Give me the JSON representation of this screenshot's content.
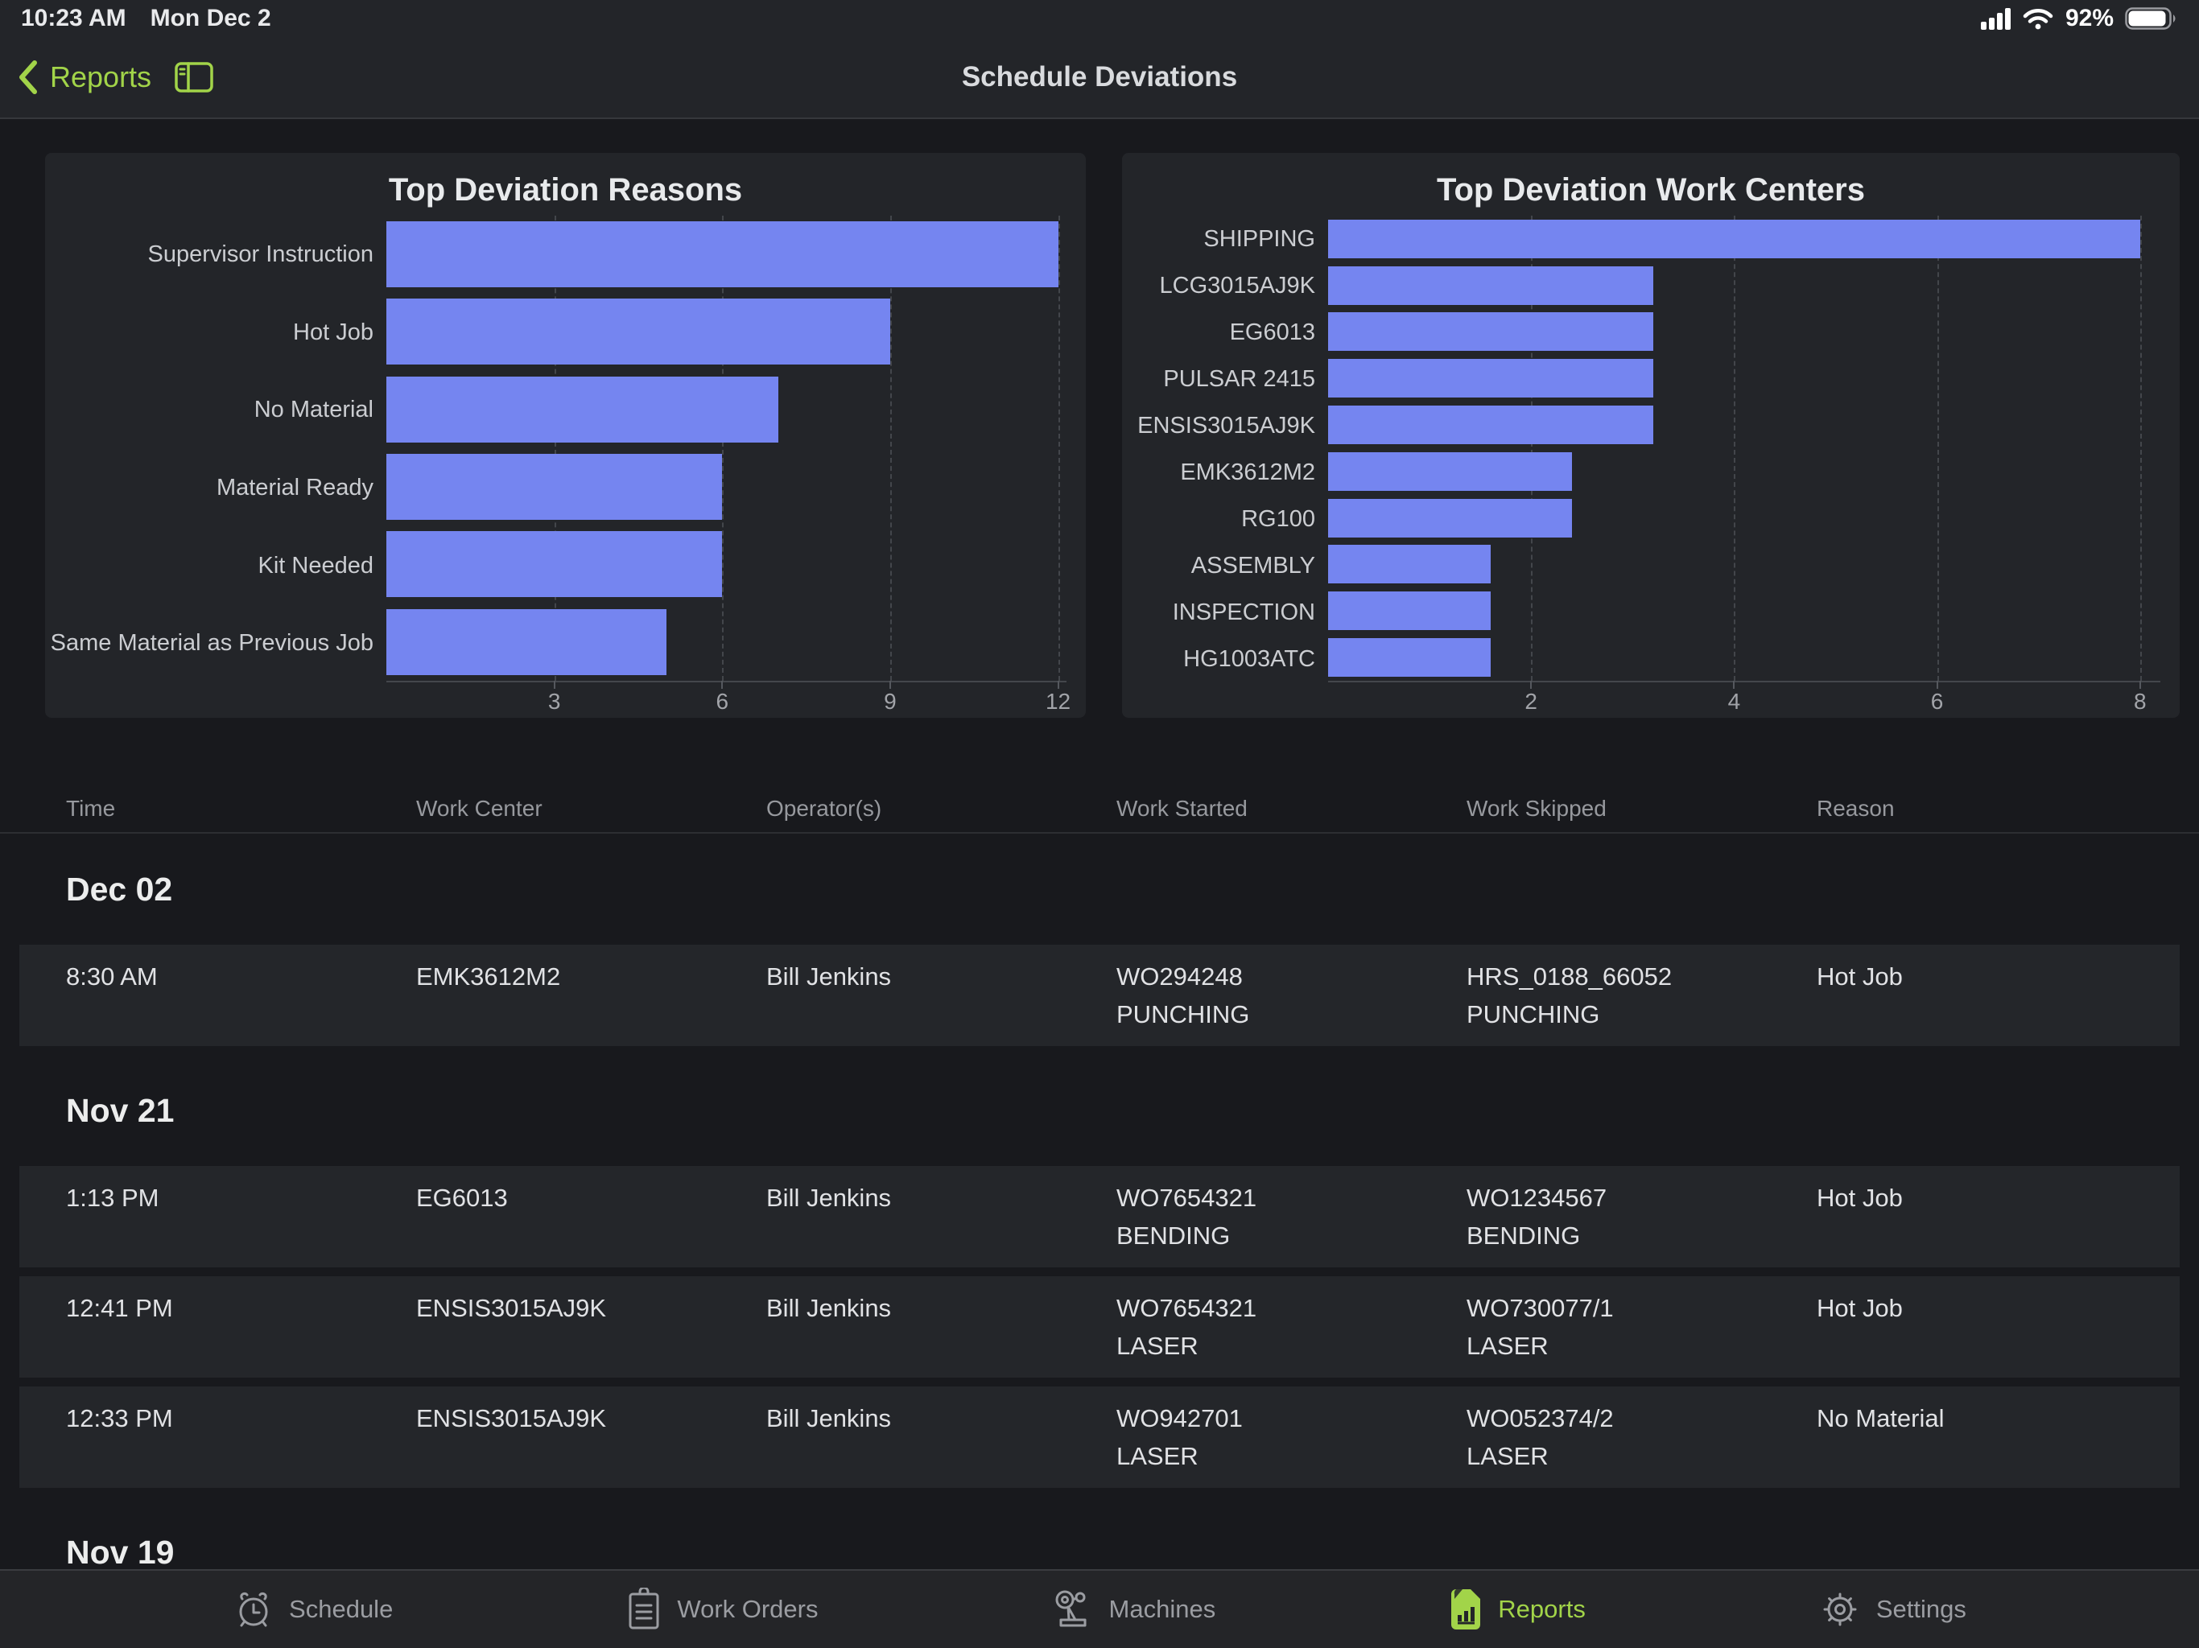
{
  "status_bar": {
    "time": "10:23 AM",
    "date": "Mon Dec 2",
    "battery_percent": "92%"
  },
  "nav": {
    "back_label": "Reports",
    "title": "Schedule Deviations"
  },
  "colors": {
    "accent_green": "#a2d449",
    "bar_blue": "#7585f0",
    "card_bg": "#232529",
    "page_bg": "#18191d"
  },
  "chart_data": [
    {
      "type": "bar",
      "orientation": "horizontal",
      "title": "Top Deviation Reasons",
      "categories": [
        "Supervisor Instruction",
        "Hot Job",
        "No Material",
        "Material Ready",
        "Kit Needed",
        "Same Material as Previous Job"
      ],
      "values": [
        12,
        9,
        7,
        6,
        6,
        5
      ],
      "xticks": [
        3,
        6,
        9,
        12
      ],
      "xlim": [
        0,
        12.15
      ],
      "xlabel": "",
      "ylabel": "",
      "grid": "dashed-vertical",
      "legend": "none"
    },
    {
      "type": "bar",
      "orientation": "horizontal",
      "title": "Top Deviation Work Centers",
      "categories": [
        "SHIPPING",
        "LCG3015AJ9K",
        "EG6013",
        "PULSAR 2415",
        "ENSIS3015AJ9K",
        "EMK3612M2",
        "RG100",
        "ASSEMBLY",
        "INSPECTION",
        "HG1003ATC"
      ],
      "values": [
        8,
        3.2,
        3.2,
        3.2,
        3.2,
        2.4,
        2.4,
        1.6,
        1.6,
        1.6
      ],
      "xticks": [
        2,
        4,
        6,
        8
      ],
      "xlim": [
        0,
        8.2
      ],
      "xlabel": "",
      "ylabel": "",
      "grid": "dashed-vertical",
      "legend": "none"
    }
  ],
  "table": {
    "columns": [
      "Time",
      "Work Center",
      "Operator(s)",
      "Work Started",
      "Work Skipped",
      "Reason"
    ],
    "sections": [
      {
        "date": "Dec 02",
        "rows": [
          {
            "time": "8:30 AM",
            "work_center": "EMK3612M2",
            "operators": "Bill Jenkins",
            "work_started": [
              "WO294248",
              "PUNCHING"
            ],
            "work_skipped": [
              "HRS_0188_66052",
              "PUNCHING"
            ],
            "reason": "Hot Job"
          }
        ]
      },
      {
        "date": "Nov 21",
        "rows": [
          {
            "time": "1:13 PM",
            "work_center": "EG6013",
            "operators": "Bill Jenkins",
            "work_started": [
              "WO7654321",
              "BENDING"
            ],
            "work_skipped": [
              "WO1234567",
              "BENDING"
            ],
            "reason": "Hot Job"
          },
          {
            "time": "12:41 PM",
            "work_center": "ENSIS3015AJ9K",
            "operators": "Bill Jenkins",
            "work_started": [
              "WO7654321",
              "LASER"
            ],
            "work_skipped": [
              "WO730077/1",
              "LASER"
            ],
            "reason": "Hot Job"
          },
          {
            "time": "12:33 PM",
            "work_center": "ENSIS3015AJ9K",
            "operators": "Bill Jenkins",
            "work_started": [
              "WO942701",
              "LASER"
            ],
            "work_skipped": [
              "WO052374/2",
              "LASER"
            ],
            "reason": "No Material"
          }
        ]
      },
      {
        "date": "Nov 19",
        "rows": []
      }
    ]
  },
  "tab_bar": {
    "tabs": [
      {
        "label": "Schedule",
        "icon": "alarm-clock-icon",
        "active": false
      },
      {
        "label": "Work Orders",
        "icon": "clipboard-icon",
        "active": false
      },
      {
        "label": "Machines",
        "icon": "robot-arm-icon",
        "active": false
      },
      {
        "label": "Reports",
        "icon": "report-document-icon",
        "active": true
      },
      {
        "label": "Settings",
        "icon": "gear-icon",
        "active": false
      }
    ]
  }
}
